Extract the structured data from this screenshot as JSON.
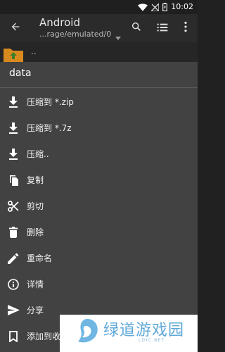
{
  "status_bar": {
    "time": "10:02",
    "icons": [
      "wifi-icon",
      "signal-off-icon",
      "battery-icon"
    ]
  },
  "app_bar": {
    "title": "Android",
    "subtitle": "...rage/emulated/0",
    "icons": [
      "back-arrow-icon",
      "search-icon",
      "list-view-icon",
      "overflow-menu-icon"
    ]
  },
  "file_list": {
    "parent_label": ".."
  },
  "sheet": {
    "title": "data",
    "items": [
      {
        "label": "压缩到 *.zip",
        "icon": "download-icon"
      },
      {
        "label": "压缩到 *.7z",
        "icon": "download-icon"
      },
      {
        "label": "压缩..",
        "icon": "download-icon"
      },
      {
        "label": "复制",
        "icon": "copy-icon"
      },
      {
        "label": "剪切",
        "icon": "scissors-icon"
      },
      {
        "label": "删除",
        "icon": "trash-icon"
      },
      {
        "label": "重命名",
        "icon": "pencil-icon"
      },
      {
        "label": "详情",
        "icon": "info-icon"
      },
      {
        "label": "分享",
        "icon": "send-icon"
      },
      {
        "label": "添加到收",
        "icon": "bookmark-icon"
      }
    ]
  },
  "watermark": {
    "text": "绿道游戏园",
    "url": "LDYC.NET"
  },
  "colors": {
    "background": "#212121",
    "app_bar": "#2b2b2b",
    "sheet": "#424242",
    "icon": "#ffffff",
    "watermark": "#5fa8d8"
  }
}
